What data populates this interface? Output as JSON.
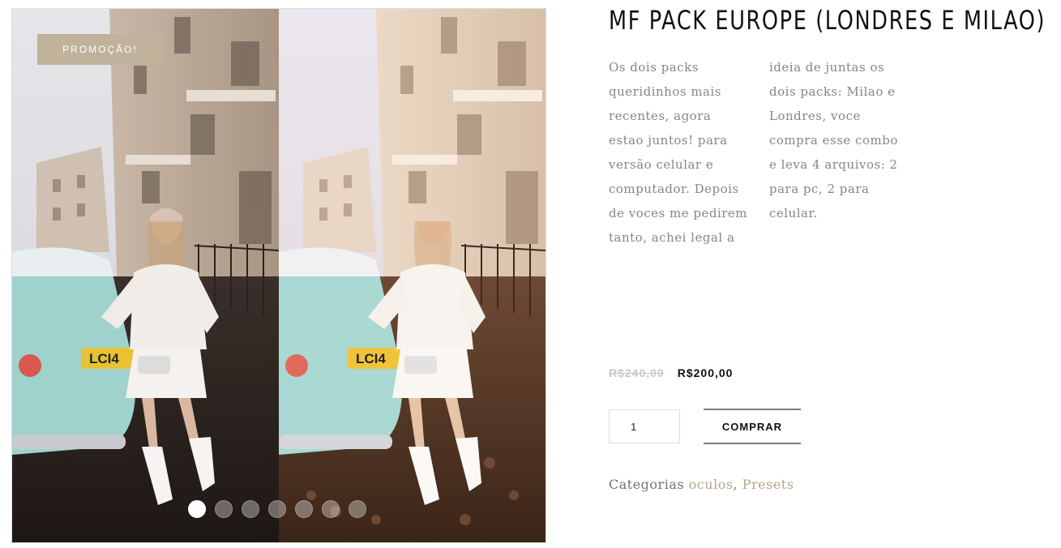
{
  "gallery": {
    "sale_badge": "PROMOÇÃO!",
    "slides_count": 7,
    "active_slide": 1
  },
  "product": {
    "title": "MF PACK EUROPE (LONDRES E MILAO)",
    "description": "Os dois packs queridinhos mais recentes, agora estao juntos! para versão celular e computador. Depois de voces me pedirem tanto, achei legal a ideia de juntas os dois packs: Milao e Londres, voce compra esse combo e leva 4 arquivos: 2 para pc, 2 para celular.",
    "price_old": "R$240,00",
    "price_new": "R$200,00",
    "quantity": "1",
    "buy_label": "COMPRAR",
    "categories_label": "Categorias",
    "categories": [
      "oculos",
      "Presets"
    ],
    "category_separator": ", "
  },
  "colors": {
    "badge": "#c0b29b",
    "link": "#b5a48a",
    "text_muted": "#8a8580"
  }
}
